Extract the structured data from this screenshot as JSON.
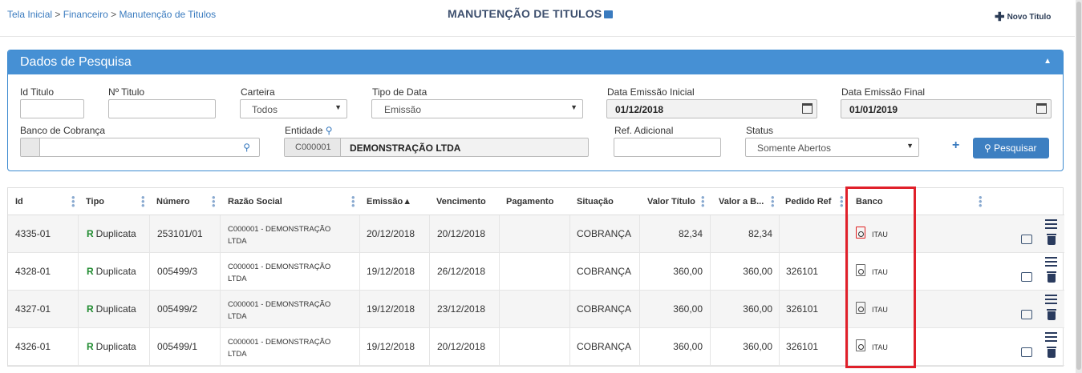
{
  "breadcrumb": {
    "home": "Tela Inicial",
    "sep1": " > ",
    "section": "Financeiro",
    "sep2": " > ",
    "current": "Manutenção de Titulos"
  },
  "page_title": "MANUTENÇÃO DE TITULOS",
  "new_button": "Novo Titulo",
  "panel_title": "Dados de Pesquisa",
  "filters": {
    "id_titulo_label": "Id Titulo",
    "n_titulo_label": "Nº Titulo",
    "carteira_label": "Carteira",
    "carteira_value": "Todos",
    "tipo_data_label": "Tipo de Data",
    "tipo_data_value": "Emissão",
    "data_ini_label": "Data Emissão Inicial",
    "data_ini_value": "01/12/2018",
    "data_fim_label": "Data Emissão Final",
    "data_fim_value": "01/01/2019",
    "banco_label": "Banco de Cobrança",
    "entidade_label": "Entidade",
    "entidade_code": "C000001",
    "entidade_name": "DEMONSTRAÇÃO LTDA",
    "ref_label": "Ref. Adicional",
    "status_label": "Status",
    "status_value": "Somente Abertos",
    "search_button": "Pesquisar"
  },
  "columns": [
    "Id",
    "Tipo",
    "Número",
    "Razão Social",
    "Emissão▲",
    "Vencimento",
    "Pagamento",
    "Situação",
    "Valor Título",
    "Valor a B...",
    "Pedido Ref",
    "Banco"
  ],
  "rows": [
    {
      "id": "4335-01",
      "tipo_badge": "R",
      "tipo": "Duplicata",
      "numero": "253101/01",
      "razao1": "C000001 - DEMONSTRAÇÃO",
      "razao2": "LTDA",
      "emissao": "20/12/2018",
      "vencimento": "20/12/2018",
      "pagamento": "",
      "situacao": "COBRANÇA",
      "valor": "82,34",
      "valor_b": "82,34",
      "pedido": "",
      "banco": "ITAU"
    },
    {
      "id": "4328-01",
      "tipo_badge": "R",
      "tipo": "Duplicata",
      "numero": "005499/3",
      "razao1": "C000001 - DEMONSTRAÇÃO",
      "razao2": "LTDA",
      "emissao": "19/12/2018",
      "vencimento": "26/12/2018",
      "pagamento": "",
      "situacao": "COBRANÇA",
      "valor": "360,00",
      "valor_b": "360,00",
      "pedido": "326101",
      "banco": "ITAU"
    },
    {
      "id": "4327-01",
      "tipo_badge": "R",
      "tipo": "Duplicata",
      "numero": "005499/2",
      "razao1": "C000001 - DEMONSTRAÇÃO",
      "razao2": "LTDA",
      "emissao": "19/12/2018",
      "vencimento": "23/12/2018",
      "pagamento": "",
      "situacao": "COBRANÇA",
      "valor": "360,00",
      "valor_b": "360,00",
      "pedido": "326101",
      "banco": "ITAU"
    },
    {
      "id": "4326-01",
      "tipo_badge": "R",
      "tipo": "Duplicata",
      "numero": "005499/1",
      "razao1": "C000001 - DEMONSTRAÇÃO",
      "razao2": "LTDA",
      "emissao": "19/12/2018",
      "vencimento": "20/12/2018",
      "pagamento": "",
      "situacao": "COBRANÇA",
      "valor": "360,00",
      "valor_b": "360,00",
      "pedido": "326101",
      "banco": "ITAU"
    }
  ],
  "colors": {
    "accent": "#4690d4",
    "highlight": "#e0202a",
    "badge_green": "#1e8a2e"
  }
}
